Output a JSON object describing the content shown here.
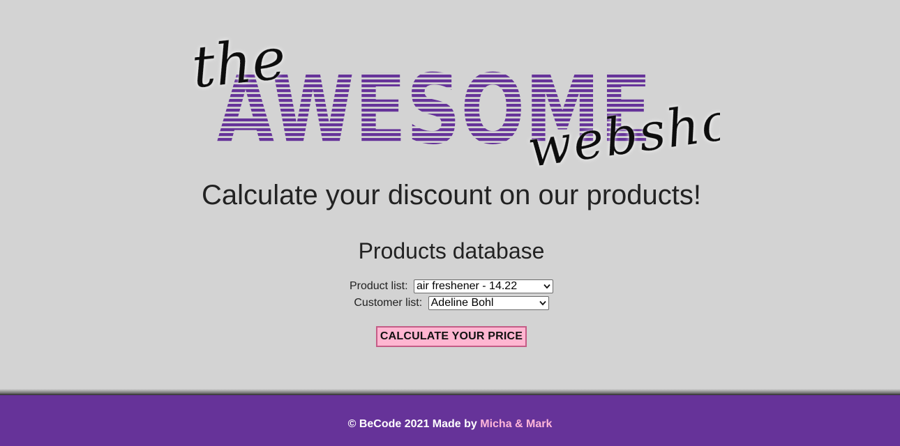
{
  "logo": {
    "word_the": "the",
    "word_awesome": "AWESOME",
    "word_webshop": "webshop",
    "stripe_color": "#663399"
  },
  "headline": "Calculate your discount on our products!",
  "section_title": "Products database",
  "form": {
    "product_label": "Product list:",
    "product_selected": "air freshener - 14.22",
    "customer_label": "Customer list:",
    "customer_selected": "Adeline Bohl",
    "calculate_label": "CALCULATE YOUR PRICE"
  },
  "footer": {
    "copyright": "© BeCode 2021 Made by ",
    "authors": "Micha & Mark"
  },
  "colors": {
    "background": "#d3d3d3",
    "footer": "#663399",
    "button": "#ffb6d1",
    "button_border": "#c45c86",
    "author_link": "#ffb6d9"
  }
}
